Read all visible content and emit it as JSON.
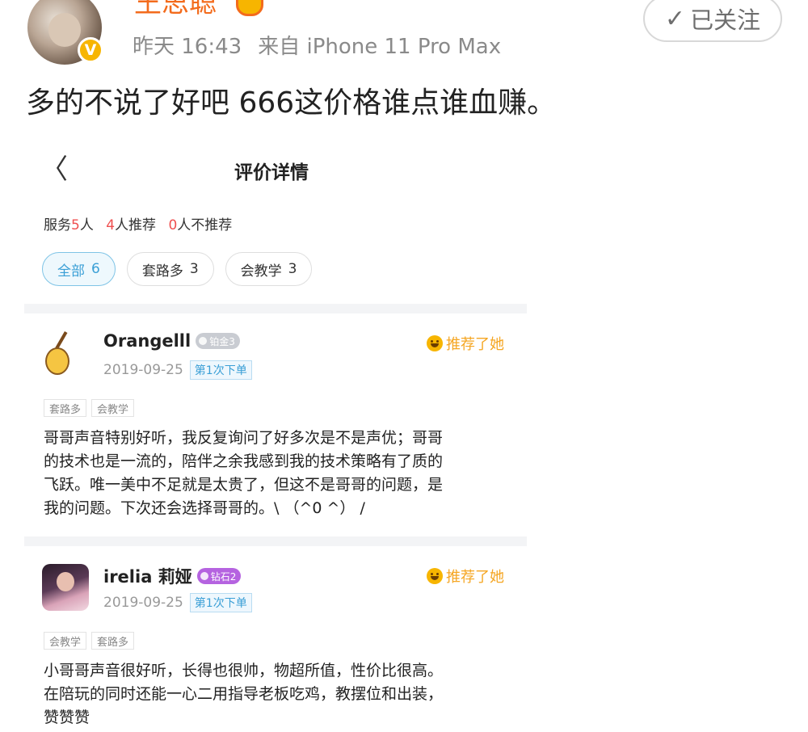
{
  "post": {
    "username": "王思聪",
    "time": "昨天 16:43",
    "source": "来自 iPhone 11 Pro Max",
    "follow_label": "已关注",
    "text": "多的不说了好吧 666这价格谁点谁血赚。"
  },
  "icons": {
    "verified": "verified-v-icon",
    "crown": "vip-crown-icon",
    "check": "check-icon",
    "back": "back-arrow-icon",
    "smile": "smile-icon"
  },
  "colors": {
    "username": "#f36b1c",
    "recommend": "#f5a623",
    "accent_blue": "#3a9fd6",
    "stat_red": "#ef4f4f"
  },
  "embed": {
    "back_glyph": "〈",
    "title": "评价详情",
    "stats": {
      "served_label": "服务",
      "served_count": "5",
      "served_unit": "人",
      "recommend_count": "4",
      "recommend_label": "人推荐",
      "not_recommend_count": "0",
      "not_recommend_label": "人不推荐"
    },
    "filters": [
      {
        "label": "全部",
        "count": "6"
      },
      {
        "label": "套路多",
        "count": "3"
      },
      {
        "label": "会教学",
        "count": "3"
      }
    ],
    "reviews": [
      {
        "name": "Orangelll",
        "badge": "铂金3",
        "recommend": "推荐了她",
        "date": "2019-09-25",
        "order": "第1次下单",
        "tags": [
          "套路多",
          "会教学"
        ],
        "lines": [
          "哥哥声音特别好听，我反复询问了好多次是不是声优；哥哥",
          "的技术也是一流的，陪伴之余我感到我的技术策略有了质的",
          "飞跃。唯一美中不足就是太贵了，但这不是哥哥的问题，是",
          "我的问题。下次还会选择哥哥的。\\ （^0 ^） /"
        ]
      },
      {
        "name": "irelia 莉娅",
        "badge": "钻石2",
        "recommend": "推荐了她",
        "date": "2019-09-25",
        "order": "第1次下单",
        "tags": [
          "会教学",
          "套路多"
        ],
        "lines": [
          "小哥哥声音很好听，长得也很帅，物超所值，性价比很高。",
          "在陪玩的同时还能一心二用指导老板吃鸡，教摆位和出装，",
          "赞赞赞"
        ]
      }
    ]
  }
}
